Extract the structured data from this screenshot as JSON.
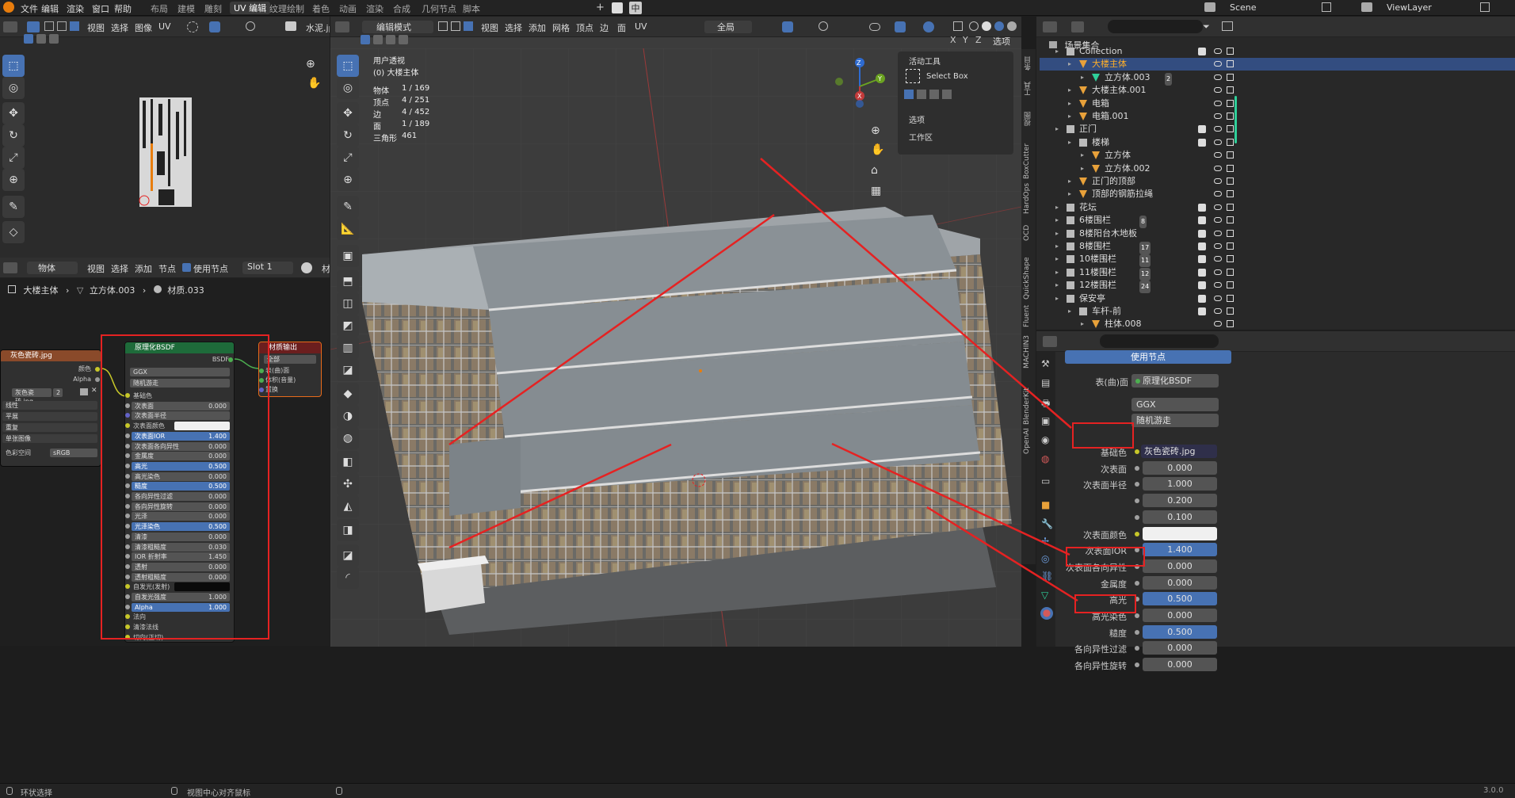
{
  "topbar": {
    "menus": [
      "文件",
      "编辑",
      "渲染",
      "窗口",
      "帮助"
    ],
    "workspaces": [
      "布局",
      "建模",
      "雕刻",
      "UV 编辑",
      "纹理绘制",
      "着色",
      "动画",
      "渲染",
      "合成",
      "几何节点",
      "脚本"
    ],
    "active_workspace": "UV 编辑",
    "lang_icon": "中",
    "scene": "Scene",
    "view_layer": "ViewLayer"
  },
  "uv_editor": {
    "menus": [
      "视图",
      "选择",
      "图像",
      "UV"
    ],
    "image_name": "水泥.jp"
  },
  "node_editor": {
    "object_mode": "物体",
    "menus": [
      "视图",
      "选择",
      "添加",
      "节点"
    ],
    "use_nodes": "使用节点",
    "slot": "Slot 1",
    "short_label": "材",
    "breadcrumb": [
      "大楼主体",
      "立方体.003",
      "材质.033"
    ]
  },
  "image_node": {
    "title": "灰色瓷砖.jpg",
    "outputs": [
      "颜色",
      "Alpha"
    ],
    "image": "灰色瓷砖.jpg",
    "image_user_count": "2",
    "options": [
      "线性",
      "平展",
      "重复",
      "单张图像"
    ],
    "colorspace_label": "色彩空间",
    "colorspace": "sRGB",
    "alpha_label": "Alpha",
    "alpha_value": "直通"
  },
  "bsdf_node": {
    "title": "原理化BSDF",
    "output": "BSDF",
    "distribution": "GGX",
    "subsurface_method": "随机游走",
    "rows": [
      {
        "label": "基础色",
        "value": "",
        "kind": "socket"
      },
      {
        "label": "次表面",
        "value": "0.000",
        "kind": "field"
      },
      {
        "label": "次表面半径",
        "value": "",
        "kind": "dropdown"
      },
      {
        "label": "次表面颜色",
        "value": "",
        "kind": "white"
      },
      {
        "label": "次表面IOR",
        "value": "1.400",
        "kind": "blue"
      },
      {
        "label": "次表面各向异性",
        "value": "0.000",
        "kind": "field"
      },
      {
        "label": "金属度",
        "value": "0.000",
        "kind": "field"
      },
      {
        "label": "高光",
        "value": "0.500",
        "kind": "blue"
      },
      {
        "label": "高光染色",
        "value": "0.000",
        "kind": "field"
      },
      {
        "label": "糙度",
        "value": "0.500",
        "kind": "blue"
      },
      {
        "label": "各向异性过滤",
        "value": "0.000",
        "kind": "field"
      },
      {
        "label": "各向异性旋转",
        "value": "0.000",
        "kind": "field"
      },
      {
        "label": "光泽",
        "value": "0.000",
        "kind": "field"
      },
      {
        "label": "光泽染色",
        "value": "0.500",
        "kind": "blue"
      },
      {
        "label": "清漆",
        "value": "0.000",
        "kind": "field"
      },
      {
        "label": "清漆粗糙度",
        "value": "0.030",
        "kind": "field"
      },
      {
        "label": "IOR 折射率",
        "value": "1.450",
        "kind": "field"
      },
      {
        "label": "透射",
        "value": "0.000",
        "kind": "field"
      },
      {
        "label": "透射粗糙度",
        "value": "0.000",
        "kind": "field"
      },
      {
        "label": "自发光(发射)",
        "value": "",
        "kind": "black"
      },
      {
        "label": "自发光强度",
        "value": "1.000",
        "kind": "field"
      },
      {
        "label": "Alpha",
        "value": "1.000",
        "kind": "blue"
      },
      {
        "label": "法向",
        "value": "",
        "kind": "socket"
      },
      {
        "label": "清漆法线",
        "value": "",
        "kind": "socket"
      },
      {
        "label": "切向(正切)",
        "value": "",
        "kind": "socket"
      }
    ]
  },
  "output_node": {
    "title": "材质输出",
    "target": "全部",
    "inputs": [
      "表(曲)面",
      "体积(音量)",
      "置换"
    ]
  },
  "viewport": {
    "mode": "编辑模式",
    "menus": [
      "视图",
      "选择",
      "添加",
      "网格",
      "顶点",
      "边",
      "面",
      "UV"
    ],
    "transform": "全局",
    "view_label": "用户透视",
    "object_label": "(0) 大楼主体",
    "stats": [
      {
        "k": "物体",
        "v": "1 / 169"
      },
      {
        "k": "顶点",
        "v": "4 / 251"
      },
      {
        "k": "边",
        "v": "4 / 452"
      },
      {
        "k": "面",
        "v": "1 / 189"
      },
      {
        "k": "三角形",
        "v": "461"
      }
    ],
    "options_label": "选项",
    "axis_x": "X",
    "axis_y": "Y",
    "axis_z": "Z"
  },
  "tool_panel": {
    "title": "活动工具",
    "tool": "Select Box",
    "options": "选项",
    "workspace": "工作区"
  },
  "side_tabs": [
    "条目",
    "工具",
    "视图",
    "BoxCutter",
    "HardOps",
    "OCD",
    "QuickShape",
    "Fluent",
    "MACHIN3",
    "BlenderKit",
    "OpenAI"
  ],
  "outliner": {
    "root": "场景集合",
    "rows": [
      {
        "indent": 1,
        "name": "Collection",
        "type": "coll"
      },
      {
        "indent": 2,
        "name": "大楼主体",
        "type": "obj",
        "sel": true
      },
      {
        "indent": 3,
        "name": "立方体.003",
        "type": "mesh",
        "badge": "2"
      },
      {
        "indent": 2,
        "name": "大楼主体.001",
        "type": "obj"
      },
      {
        "indent": 2,
        "name": "电箱",
        "type": "obj"
      },
      {
        "indent": 2,
        "name": "电箱.001",
        "type": "obj"
      },
      {
        "indent": 1,
        "name": "正门",
        "type": "coll"
      },
      {
        "indent": 2,
        "name": "楼梯",
        "type": "coll"
      },
      {
        "indent": 3,
        "name": "立方体",
        "type": "obj"
      },
      {
        "indent": 3,
        "name": "立方体.002",
        "type": "obj"
      },
      {
        "indent": 2,
        "name": "正门的顶部",
        "type": "obj"
      },
      {
        "indent": 2,
        "name": "顶部的钢筋拉绳",
        "type": "obj"
      },
      {
        "indent": 1,
        "name": "花坛",
        "type": "coll"
      },
      {
        "indent": 1,
        "name": "6楼围栏",
        "type": "coll",
        "badge": "8"
      },
      {
        "indent": 1,
        "name": "8楼阳台木地板",
        "type": "coll"
      },
      {
        "indent": 1,
        "name": "8楼围栏",
        "type": "coll",
        "badge": "17"
      },
      {
        "indent": 1,
        "name": "10楼围栏",
        "type": "coll",
        "badge": "11"
      },
      {
        "indent": 1,
        "name": "11楼围栏",
        "type": "coll",
        "badge": "12"
      },
      {
        "indent": 1,
        "name": "12楼围栏",
        "type": "coll",
        "badge": "24"
      },
      {
        "indent": 1,
        "name": "保安亭",
        "type": "coll"
      },
      {
        "indent": 2,
        "name": "车杆-前",
        "type": "coll"
      },
      {
        "indent": 3,
        "name": "柱体.008",
        "type": "obj"
      }
    ]
  },
  "properties": {
    "use_nodes_button": "使用节点",
    "surface_label": "表(曲)面",
    "surface_value": "原理化BSDF",
    "ggx": "GGX",
    "random_walk": "随机游走",
    "rows": [
      {
        "label": "基础色",
        "value": "灰色瓷砖.jpg",
        "kind": "tex"
      },
      {
        "label": "次表面",
        "value": "0.000",
        "kind": "field"
      },
      {
        "label": "次表面半径",
        "value": "1.000",
        "kind": "field"
      },
      {
        "label": "",
        "value": "0.200",
        "kind": "field"
      },
      {
        "label": "",
        "value": "0.100",
        "kind": "field"
      },
      {
        "label": "次表面颜色",
        "value": "",
        "kind": "white"
      },
      {
        "label": "次表面IOR",
        "value": "1.400",
        "kind": "blue"
      },
      {
        "label": "次表面各向异性",
        "value": "0.000",
        "kind": "field"
      },
      {
        "label": "金属度",
        "value": "0.000",
        "kind": "field"
      },
      {
        "label": "高光",
        "value": "0.500",
        "kind": "blue"
      },
      {
        "label": "高光染色",
        "value": "0.000",
        "kind": "field"
      },
      {
        "label": "糙度",
        "value": "0.500",
        "kind": "blue"
      },
      {
        "label": "各向异性过滤",
        "value": "0.000",
        "kind": "field"
      },
      {
        "label": "各向异性旋转",
        "value": "0.000",
        "kind": "field"
      }
    ]
  },
  "statusbar": {
    "left": "环状选择",
    "mid": "视图中心对齐鼠标",
    "version": "3.0.0"
  }
}
